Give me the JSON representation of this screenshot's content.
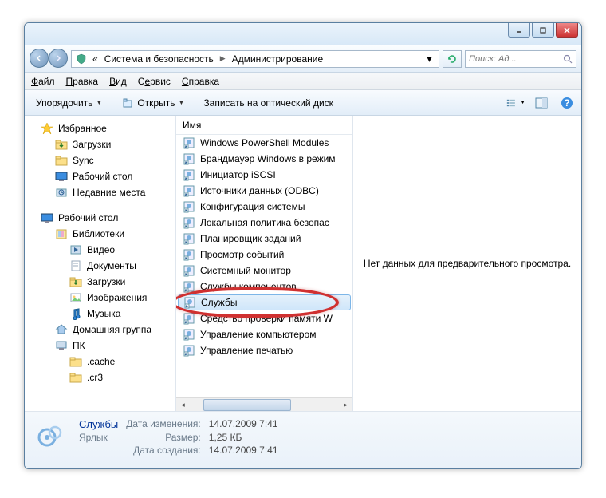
{
  "breadcrumb": {
    "prefix": "«",
    "level1": "Система и безопасность",
    "level2": "Администрирование"
  },
  "search": {
    "placeholder": "Поиск: Ад..."
  },
  "menu": {
    "file": "Файл",
    "edit": "Правка",
    "view": "Вид",
    "tools": "Сервис",
    "help": "Справка"
  },
  "toolbar": {
    "organize": "Упорядочить",
    "open": "Открыть",
    "burn": "Записать на оптический диск"
  },
  "col_header": "Имя",
  "sidebar": {
    "group1": [
      {
        "label": "Избранное",
        "icon": "star"
      },
      {
        "label": "Загрузки",
        "icon": "folder-dl",
        "lvl": 2
      },
      {
        "label": "Sync",
        "icon": "folder",
        "lvl": 2
      },
      {
        "label": "Рабочий стол",
        "icon": "desktop",
        "lvl": 2
      },
      {
        "label": "Недавние места",
        "icon": "recent",
        "lvl": 2
      }
    ],
    "group2": [
      {
        "label": "Рабочий стол",
        "icon": "desktop"
      },
      {
        "label": "Библиотеки",
        "icon": "libs",
        "lvl": 2
      },
      {
        "label": "Видео",
        "icon": "video",
        "lvl": 3
      },
      {
        "label": "Документы",
        "icon": "docs",
        "lvl": 3
      },
      {
        "label": "Загрузки",
        "icon": "folder-dl",
        "lvl": 3
      },
      {
        "label": "Изображения",
        "icon": "images",
        "lvl": 3
      },
      {
        "label": "Музыка",
        "icon": "music",
        "lvl": 3
      },
      {
        "label": "Домашняя группа",
        "icon": "home",
        "lvl": 2
      },
      {
        "label": "ПК",
        "icon": "pc",
        "lvl": 2
      },
      {
        "label": ".cache",
        "icon": "folder",
        "lvl": 3
      },
      {
        "label": ".cr3",
        "icon": "folder",
        "lvl": 3
      }
    ]
  },
  "files": [
    {
      "label": "Windows PowerShell Modules",
      "sel": false
    },
    {
      "label": "Брандмауэр Windows в режим",
      "sel": false
    },
    {
      "label": "Инициатор iSCSI",
      "sel": false
    },
    {
      "label": "Источники данных (ODBC)",
      "sel": false
    },
    {
      "label": "Конфигурация системы",
      "sel": false
    },
    {
      "label": "Локальная политика безопас",
      "sel": false
    },
    {
      "label": "Планировщик заданий",
      "sel": false
    },
    {
      "label": "Просмотр событий",
      "sel": false
    },
    {
      "label": "Системный монитор",
      "sel": false
    },
    {
      "label": "Службы компонентов",
      "sel": false
    },
    {
      "label": "Службы",
      "sel": true
    },
    {
      "label": "Средство проверки памяти W",
      "sel": false
    },
    {
      "label": "Управление компьютером",
      "sel": false
    },
    {
      "label": "Управление печатью",
      "sel": false
    }
  ],
  "preview_text": "Нет данных для предварительного просмотра.",
  "details": {
    "name": "Службы",
    "type": "Ярлык",
    "date_mod_lbl": "Дата изменения:",
    "date_mod": "14.07.2009 7:41",
    "size_lbl": "Размер:",
    "size": "1,25 КБ",
    "date_cr_lbl": "Дата создания:",
    "date_cr": "14.07.2009 7:41"
  }
}
